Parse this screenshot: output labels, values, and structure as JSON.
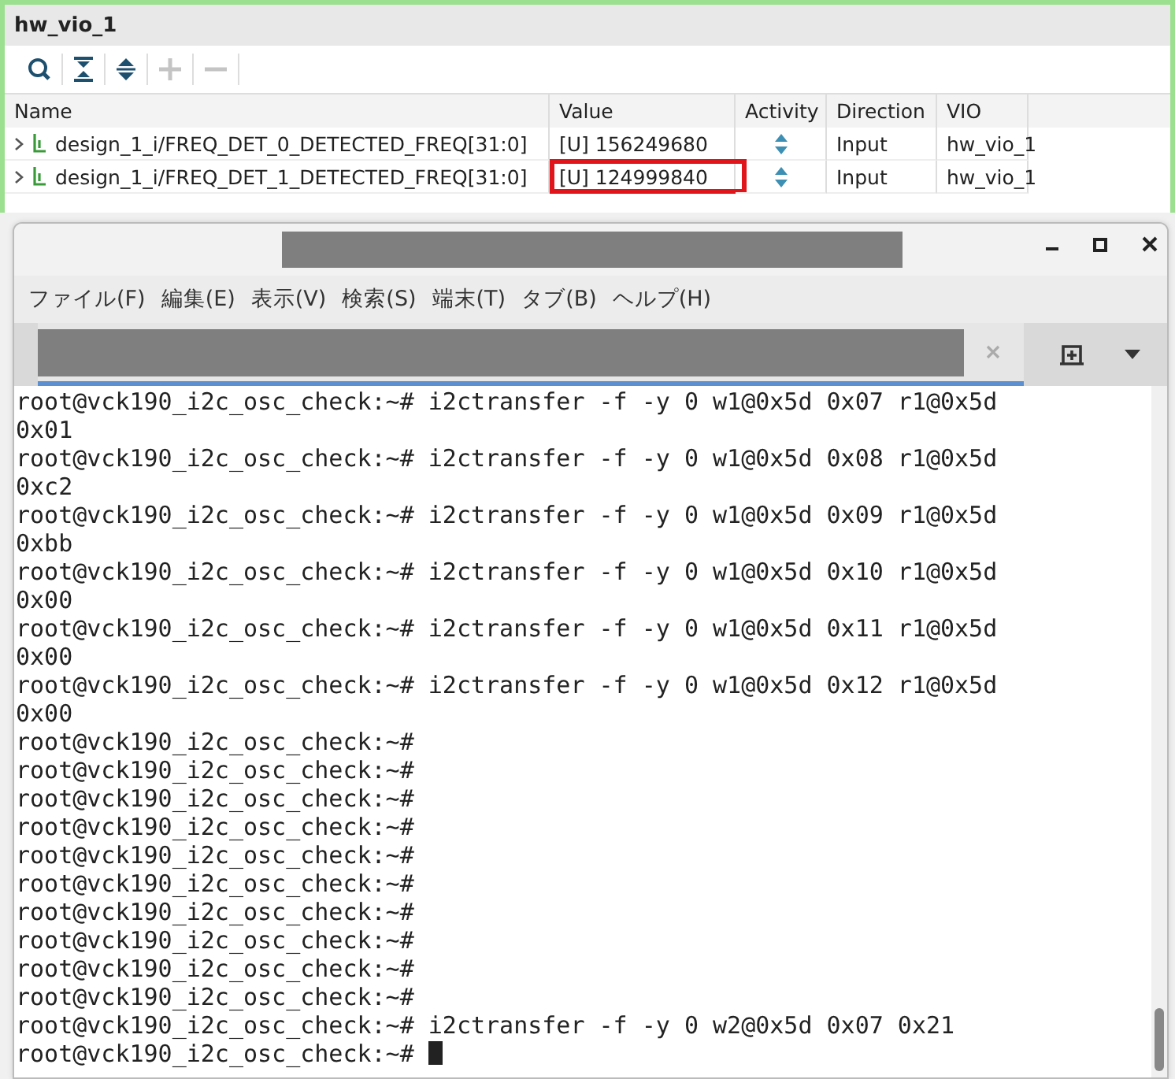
{
  "vio_panel": {
    "title": "hw_vio_1",
    "toolbar": [
      {
        "kind": "search",
        "disabled": false
      },
      {
        "kind": "collapse",
        "disabled": false
      },
      {
        "kind": "expand",
        "disabled": false
      },
      {
        "kind": "add",
        "disabled": true
      },
      {
        "kind": "remove",
        "disabled": true
      }
    ],
    "columns": [
      "Name",
      "Value",
      "Activity",
      "Direction",
      "VIO"
    ],
    "rows": [
      {
        "name": "design_1_i/FREQ_DET_0_DETECTED_FREQ[31:0]",
        "value": "[U] 156249680",
        "highlighted": false,
        "direction": "Input",
        "vio": "hw_vio_1"
      },
      {
        "name": "design_1_i/FREQ_DET_1_DETECTED_FREQ[31:0]",
        "value": "[U] 124999840",
        "highlighted": true,
        "direction": "Input",
        "vio": "hw_vio_1"
      }
    ]
  },
  "terminal": {
    "menu": [
      "ファイル(F)",
      "編集(E)",
      "表示(V)",
      "検索(S)",
      "端末(T)",
      "タブ(B)",
      "ヘルプ(H)"
    ],
    "lines": [
      "root@vck190_i2c_osc_check:~# i2ctransfer -f -y 0 w1@0x5d 0x07 r1@0x5d",
      "0x01",
      "root@vck190_i2c_osc_check:~# i2ctransfer -f -y 0 w1@0x5d 0x08 r1@0x5d",
      "0xc2",
      "root@vck190_i2c_osc_check:~# i2ctransfer -f -y 0 w1@0x5d 0x09 r1@0x5d",
      "0xbb",
      "root@vck190_i2c_osc_check:~# i2ctransfer -f -y 0 w1@0x5d 0x10 r1@0x5d",
      "0x00",
      "root@vck190_i2c_osc_check:~# i2ctransfer -f -y 0 w1@0x5d 0x11 r1@0x5d",
      "0x00",
      "root@vck190_i2c_osc_check:~# i2ctransfer -f -y 0 w1@0x5d 0x12 r1@0x5d",
      "0x00",
      "root@vck190_i2c_osc_check:~#",
      "root@vck190_i2c_osc_check:~#",
      "root@vck190_i2c_osc_check:~#",
      "root@vck190_i2c_osc_check:~#",
      "root@vck190_i2c_osc_check:~#",
      "root@vck190_i2c_osc_check:~#",
      "root@vck190_i2c_osc_check:~#",
      "root@vck190_i2c_osc_check:~#",
      "root@vck190_i2c_osc_check:~#",
      "root@vck190_i2c_osc_check:~#",
      "root@vck190_i2c_osc_check:~# i2ctransfer -f -y 0 w2@0x5d 0x07 0x21",
      "root@vck190_i2c_osc_check:~#"
    ]
  }
}
